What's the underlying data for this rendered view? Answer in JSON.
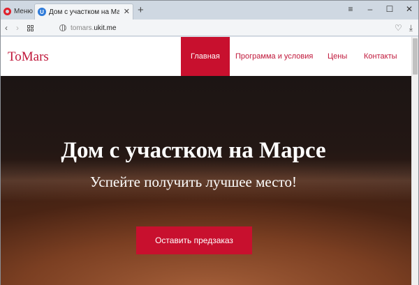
{
  "browser": {
    "menu_label": "Меню",
    "tab_title": "Дом с участком на Марсе",
    "favicon_letter": "U",
    "url_host_prefix": "tomars.",
    "url_host_main": "ukit.me"
  },
  "site": {
    "logo": "ToMars",
    "nav": [
      {
        "label": "Главная",
        "active": true
      },
      {
        "label": "Программа и условия",
        "active": false
      },
      {
        "label": "Цены",
        "active": false
      },
      {
        "label": "Контакты",
        "active": false
      }
    ]
  },
  "hero": {
    "title": "Дом с участком на Марсе",
    "subtitle": "Успейте получить лучшее место!",
    "cta_label": "Оставить предзаказ"
  },
  "colors": {
    "brand": "#c8102e",
    "brand_text": "#c0173a"
  }
}
